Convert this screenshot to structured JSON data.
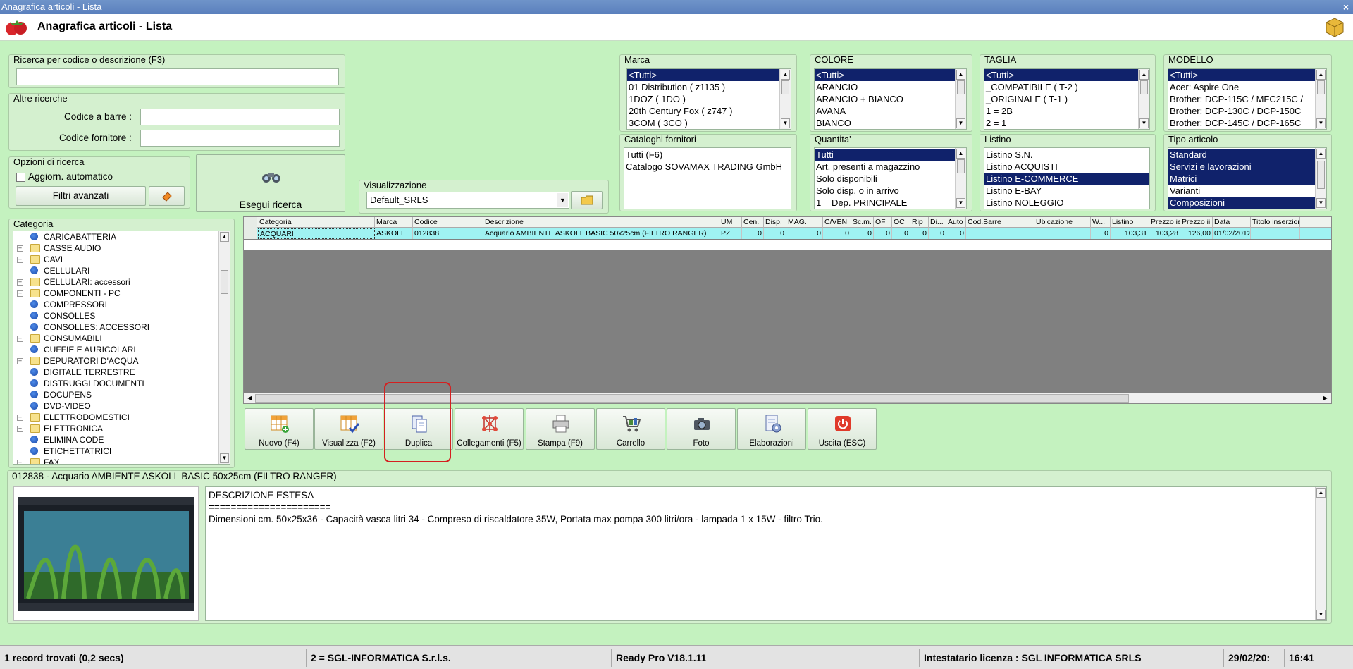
{
  "window": {
    "title": "Anagrafica articoli  - Lista",
    "close": "×"
  },
  "header": {
    "title": "Anagrafica articoli  - Lista"
  },
  "search": {
    "group_title": "Ricerca per codice o descrizione (F3)",
    "value": "",
    "other_title": "Altre ricerche",
    "barcode_label": "Codice a barre :",
    "barcode_value": "",
    "supplier_label": "Codice fornitore :",
    "supplier_value": ""
  },
  "options": {
    "title": "Opzioni di ricerca",
    "auto_update_label": "Aggiorn. automatico",
    "advanced_filters": "Filtri avanzati",
    "execute": "Esegui ricerca"
  },
  "view": {
    "title": "Visualizzazione",
    "selected": "Default_SRLS"
  },
  "filters": {
    "marca": {
      "title": "Marca",
      "items": [
        "<Tutti>",
        "01 Distribution ( z1135 )",
        "1DOZ ( 1DO )",
        "20th Century Fox ( z747 )",
        "3COM ( 3CO )"
      ]
    },
    "colore": {
      "title": "COLORE",
      "items": [
        "<Tutti>",
        "ARANCIO",
        "ARANCIO + BIANCO",
        "AVANA",
        "BIANCO"
      ]
    },
    "taglia": {
      "title": "TAGLIA",
      "items": [
        "<Tutti>",
        "_COMPATIBILE ( T-2 )",
        "_ORIGINALE ( T-1 )",
        "1 = 2B",
        "2 = 1"
      ]
    },
    "modello": {
      "title": "MODELLO",
      "items": [
        "<Tutti>",
        "Acer: Aspire One",
        "Brother: DCP-115C / MFC215C /",
        "Brother: DCP-130C / DCP-150C",
        "Brother: DCP-145C / DCP-165C"
      ]
    },
    "cataloghi": {
      "title": "Cataloghi fornitori",
      "items": [
        "Tutti (F6)",
        "Catalogo SOVAMAX TRADING GmbH"
      ]
    },
    "quantita": {
      "title": "Quantita'",
      "items": [
        "Tutti",
        "Art. presenti a magazzino",
        "Solo disponibili",
        "Solo disp. o in arrivo",
        "1 = Dep. PRINCIPALE"
      ]
    },
    "listino": {
      "title": "Listino",
      "items": [
        "Listino S.N.",
        "Listino ACQUISTI",
        "Listino E-COMMERCE",
        "Listino E-BAY",
        "Listino NOLEGGIO"
      ]
    },
    "tipo": {
      "title": "Tipo articolo",
      "items": [
        "Standard",
        "Servizi e lavorazioni",
        "Matrici",
        "Varianti",
        "Composizioni"
      ]
    }
  },
  "categoria": {
    "title": "Categoria",
    "items": [
      {
        "label": "CARICABATTERIA",
        "type": "leaf",
        "exp": ""
      },
      {
        "label": "CASSE AUDIO",
        "type": "folder",
        "exp": "+"
      },
      {
        "label": "CAVI",
        "type": "folder",
        "exp": "+"
      },
      {
        "label": "CELLULARI",
        "type": "leaf",
        "exp": ""
      },
      {
        "label": "CELLULARI: accessori",
        "type": "folder",
        "exp": "+"
      },
      {
        "label": "COMPONENTI - PC",
        "type": "folder",
        "exp": "+"
      },
      {
        "label": "COMPRESSORI",
        "type": "leaf",
        "exp": ""
      },
      {
        "label": "CONSOLLES",
        "type": "leaf",
        "exp": ""
      },
      {
        "label": "CONSOLLES: ACCESSORI",
        "type": "leaf",
        "exp": ""
      },
      {
        "label": "CONSUMABILI",
        "type": "folder",
        "exp": "+"
      },
      {
        "label": "CUFFIE E AURICOLARI",
        "type": "leaf",
        "exp": ""
      },
      {
        "label": "DEPURATORI D'ACQUA",
        "type": "folder",
        "exp": "+"
      },
      {
        "label": "DIGITALE TERRESTRE",
        "type": "leaf",
        "exp": ""
      },
      {
        "label": "DISTRUGGI DOCUMENTI",
        "type": "leaf",
        "exp": ""
      },
      {
        "label": "DOCUPENS",
        "type": "leaf",
        "exp": ""
      },
      {
        "label": "DVD-VIDEO",
        "type": "leaf",
        "exp": ""
      },
      {
        "label": "ELETTRODOMESTICI",
        "type": "folder",
        "exp": "+"
      },
      {
        "label": "ELETTRONICA",
        "type": "folder",
        "exp": "+"
      },
      {
        "label": "ELIMINA CODE",
        "type": "leaf",
        "exp": ""
      },
      {
        "label": "ETICHETTATRICI",
        "type": "leaf",
        "exp": ""
      },
      {
        "label": "FAX",
        "type": "folder",
        "exp": "+"
      }
    ]
  },
  "table": {
    "columns": [
      "Categoria",
      "Marca",
      "Codice",
      "Descrizione",
      "UM",
      "Cen.",
      "Disp.",
      "MAG.",
      "C/VEN",
      "Sc.m.",
      "OF",
      "OC",
      "Rip",
      "Di...",
      "Auto",
      "Cod.Barre",
      "Ubicazione",
      "W...",
      "Listino",
      "Prezzo ie",
      "Prezzo ii",
      "Data",
      "Titolo inserzion"
    ],
    "rows": [
      [
        "ACQUARI",
        "ASKOLL",
        "012838",
        "Acquario AMBIENTE ASKOLL BASIC 50x25cm (FILTRO RANGER)",
        "PZ",
        "0",
        "0",
        "0",
        "0",
        "0",
        "0",
        "0",
        "0",
        "0",
        "0",
        "",
        "",
        "0",
        "103,31",
        "103,28",
        "126,00",
        "01/02/2012",
        ""
      ]
    ]
  },
  "toolbar": {
    "nuovo": "Nuovo (F4)",
    "visualizza": "Visualizza (F2)",
    "duplica": "Duplica",
    "collegamenti": "Collegamenti (F5)",
    "stampa": "Stampa (F9)",
    "carrello": "Carrello",
    "foto": "Foto",
    "elaborazioni": "Elaborazioni",
    "uscita": "Uscita (ESC)"
  },
  "detail": {
    "title": "012838 - Acquario AMBIENTE ASKOLL BASIC 50x25cm (FILTRO RANGER)",
    "heading": "DESCRIZIONE ESTESA",
    "separator": "======================",
    "text": "Dimensioni cm. 50x25x36 - Capacità vasca litri 34 - Compreso di riscaldatore 35W, Portata max pompa 300 litri/ora - lampada 1 x 15W - filtro Trio."
  },
  "status": {
    "records": "1 record trovati (0,2 secs)",
    "company": "2 = SGL-INFORMATICA S.r.l.s.",
    "version": "Ready Pro V18.1.11",
    "license": "Intestatario licenza : SGL INFORMATICA SRLS",
    "date": "29/02/20:",
    "time": "16:41"
  },
  "colors": {
    "selection": "#10226b",
    "row_highlight": "#9ff2f2",
    "background": "#c4f2bf",
    "focus_ring": "#d42020"
  }
}
